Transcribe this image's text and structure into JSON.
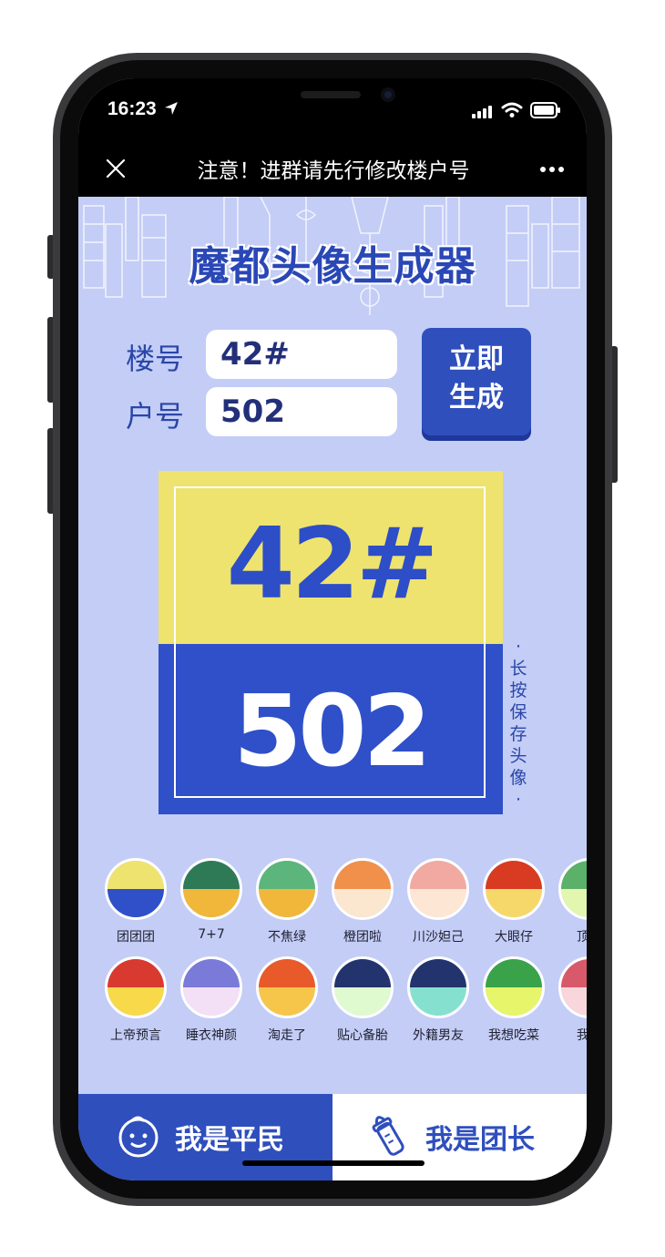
{
  "status_bar": {
    "time": "16:23"
  },
  "nav": {
    "title": "注意！进群请先行修改楼户号",
    "close_icon": "close-icon",
    "more_icon": "more-icon"
  },
  "page": {
    "title": "魔都头像生成器"
  },
  "form": {
    "building_label": "楼号",
    "building_value": "42#",
    "unit_label": "户号",
    "unit_value": "502",
    "generate_label_line1": "立即",
    "generate_label_line2": "生成"
  },
  "avatar": {
    "building": "42#",
    "unit": "502",
    "top_color": "#eee36e",
    "bottom_color": "#2f50c9"
  },
  "save_hint": {
    "dot_top": "·",
    "chars": [
      "长",
      "按",
      "保",
      "存",
      "头",
      "像"
    ],
    "dot_bottom": "·"
  },
  "themes_row1": [
    {
      "label": "团团团",
      "top": "#eee36e",
      "bottom": "#2f50c9"
    },
    {
      "label": "7+7",
      "top": "#2e7a57",
      "bottom": "#f0b73a"
    },
    {
      "label": "不焦绿",
      "top": "#5cb57a",
      "bottom": "#f0b73a"
    },
    {
      "label": "橙团啦",
      "top": "#f0904a",
      "bottom": "#fbe6cf"
    },
    {
      "label": "川沙妲己",
      "top": "#f2a9a2",
      "bottom": "#fde6d3"
    },
    {
      "label": "大眼仔",
      "top": "#d83a22",
      "bottom": "#f6d86a"
    },
    {
      "label": "顶流",
      "top": "#5bb06a",
      "bottom": "#e2f6b0"
    }
  ],
  "themes_row2": [
    {
      "label": "上帝预言",
      "top": "#d83a30",
      "bottom": "#f7d94a"
    },
    {
      "label": "睡衣神颜",
      "top": "#7a7ad8",
      "bottom": "#f4e0f6"
    },
    {
      "label": "淘走了",
      "top": "#e85a2a",
      "bottom": "#f6c64a"
    },
    {
      "label": "贴心备胎",
      "top": "#22336e",
      "bottom": "#e0fad0"
    },
    {
      "label": "外籍男友",
      "top": "#22336e",
      "bottom": "#86e0d0"
    },
    {
      "label": "我想吃菜",
      "top": "#3aa34a",
      "bottom": "#e6f56a"
    },
    {
      "label": "我想",
      "top": "#d85a6a",
      "bottom": "#f8d6dc"
    }
  ],
  "tabs": {
    "civilian": "我是平民",
    "leader": "我是团长",
    "civilian_icon": "baby-face-icon",
    "leader_icon": "baby-bottle-icon"
  }
}
